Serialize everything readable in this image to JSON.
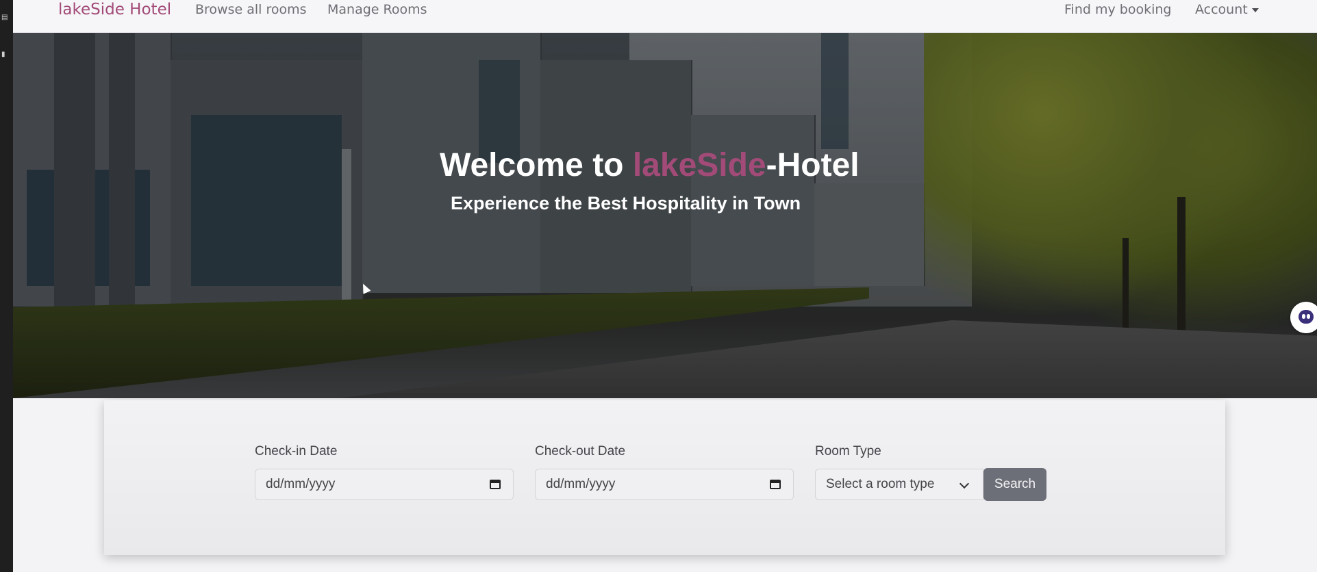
{
  "navbar": {
    "brand": "lakeSide Hotel",
    "links": [
      "Browse all rooms",
      "Manage Rooms"
    ],
    "right_links": [
      "Find my booking",
      "Account"
    ]
  },
  "hero": {
    "title_prefix": "Welcome to ",
    "title_accent": "lakeSide",
    "title_suffix": "-Hotel",
    "subtitle": "Experience the Best Hospitality in Town"
  },
  "search": {
    "checkin_label": "Check-in Date",
    "checkin_placeholder": "dd/mm/yyyy",
    "checkout_label": "Check-out Date",
    "checkout_placeholder": "dd/mm/yyyy",
    "room_type_label": "Room Type",
    "room_type_selected": "Select a room type",
    "search_button": "Search"
  },
  "colors": {
    "accent": "#a34b78",
    "button": "#6c6f77"
  },
  "icons": [
    "calendar-icon",
    "chevron-down-icon",
    "caret-down-icon",
    "chat-assistant-icon"
  ]
}
